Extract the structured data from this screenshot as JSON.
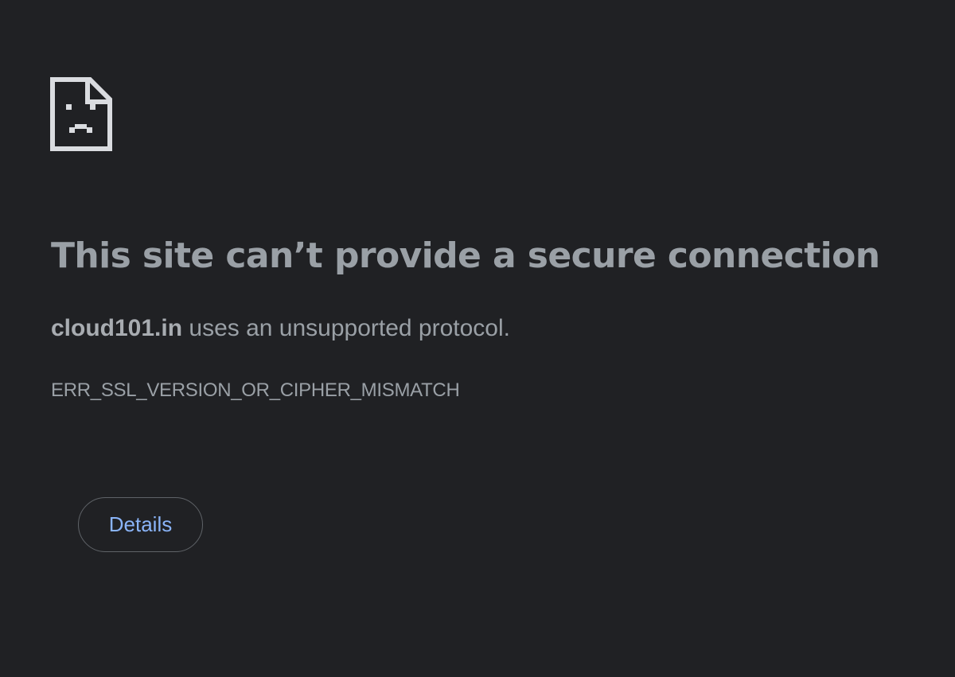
{
  "error": {
    "icon": "sad-page-icon",
    "headline": "This site can’t provide a secure connection",
    "domain": "cloud101.in",
    "summary_rest": " uses an unsupported protocol.",
    "code": "ERR_SSL_VERSION_OR_CIPHER_MISMATCH"
  },
  "actions": {
    "details_label": "Details"
  },
  "colors": {
    "background": "#202124",
    "text": "#9aa0a6",
    "link": "#8ab4f8",
    "border": "#5f6368"
  }
}
